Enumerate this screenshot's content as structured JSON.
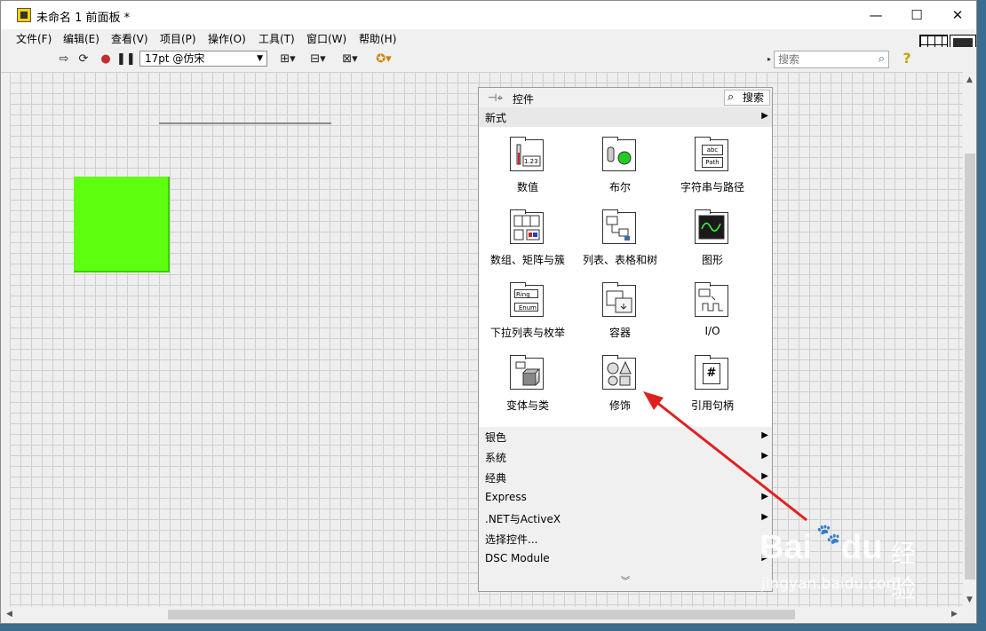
{
  "window": {
    "title": "未命名 1 前面板 *",
    "minimize": "—",
    "maximize": "☐",
    "close": "✕"
  },
  "menubar": [
    "文件(F)",
    "编辑(E)",
    "查看(V)",
    "项目(P)",
    "操作(O)",
    "工具(T)",
    "窗口(W)",
    "帮助(H)"
  ],
  "toolbar": {
    "font_value": "17pt @仿宋",
    "search_placeholder": "搜索"
  },
  "palette": {
    "title": "控件",
    "search_label": "搜索",
    "section_open": "新式",
    "controls": [
      {
        "label": "数值",
        "icon": "numeric-icon"
      },
      {
        "label": "布尔",
        "icon": "boolean-icon"
      },
      {
        "label": "字符串与路径",
        "icon": "string-path-icon"
      },
      {
        "label": "数组、矩阵与簇",
        "icon": "array-matrix-cluster-icon"
      },
      {
        "label": "列表、表格和树",
        "icon": "list-table-tree-icon"
      },
      {
        "label": "图形",
        "icon": "graph-icon"
      },
      {
        "label": "下拉列表与枚举",
        "icon": "ring-enum-icon"
      },
      {
        "label": "容器",
        "icon": "containers-icon"
      },
      {
        "label": "I/O",
        "icon": "io-icon"
      },
      {
        "label": "变体与类",
        "icon": "variant-class-icon"
      },
      {
        "label": "修饰",
        "icon": "decorations-icon"
      },
      {
        "label": "引用句柄",
        "icon": "refnum-icon"
      }
    ],
    "categories": [
      "银色",
      "系统",
      "经典",
      "Express",
      ".NET与ActiveX",
      "选择控件...",
      "DSC Module"
    ],
    "icon_text": {
      "abc": "abc",
      "path": "Path",
      "ring": "Ring",
      "enum": "Enum",
      "num": "1.23",
      "hash": "#"
    }
  },
  "watermark": {
    "brand": "Bai",
    "brand2": "du",
    "cn": "经验",
    "url": "jingyan.baidu.com"
  },
  "colors": {
    "green_box": "#5fff10",
    "arrow": "#e02020"
  }
}
